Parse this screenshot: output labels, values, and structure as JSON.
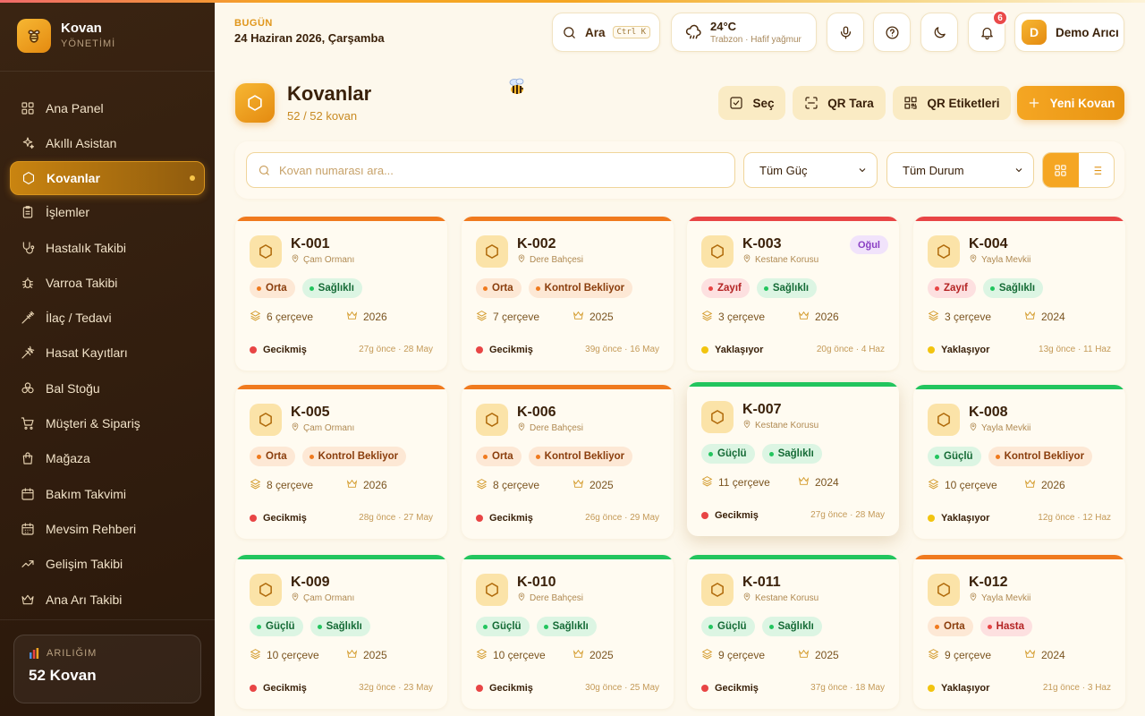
{
  "brand": {
    "title": "Kovan",
    "subtitle": "YÖNETİMİ"
  },
  "nav": [
    {
      "label": "Ana Panel",
      "icon": "grid-icon"
    },
    {
      "label": "Akıllı Asistan",
      "icon": "sparkles-icon"
    },
    {
      "label": "Kovanlar",
      "icon": "hexagon-icon",
      "active": true
    },
    {
      "label": "İşlemler",
      "icon": "clipboard-icon"
    },
    {
      "label": "Hastalık Takibi",
      "icon": "stethoscope-icon"
    },
    {
      "label": "Varroa Takibi",
      "icon": "bug-icon"
    },
    {
      "label": "İlaç / Tedavi",
      "icon": "syringe-icon"
    },
    {
      "label": "Hasat Kayıtları",
      "icon": "wheat-icon"
    },
    {
      "label": "Bal Stoğu",
      "icon": "boxes-icon"
    },
    {
      "label": "Müşteri & Sipariş",
      "icon": "cart-icon"
    },
    {
      "label": "Mağaza",
      "icon": "bag-icon"
    },
    {
      "label": "Bakım Takvimi",
      "icon": "calendar-icon"
    },
    {
      "label": "Mevsim Rehberi",
      "icon": "calendar-days-icon"
    },
    {
      "label": "Gelişim Takibi",
      "icon": "trending-up-icon"
    },
    {
      "label": "Ana Arı Takibi",
      "icon": "crown-icon"
    }
  ],
  "apiary": {
    "label": "ARILIĞIM",
    "value": "52 Kovan"
  },
  "header": {
    "date_label": "BUGÜN",
    "date_value": "24 Haziran 2026, Çarşamba",
    "search_label": "Ara",
    "search_shortcut": "Ctrl K",
    "weather_temp": "24°C",
    "weather_desc": "Trabzon · Hafif yağmur",
    "notification_count": "6",
    "user_initial": "D",
    "user_name": "Demo Arıcı"
  },
  "page": {
    "title": "Kovanlar",
    "subtitle": "52 / 52 kovan"
  },
  "actions": {
    "select": "Seç",
    "qr_scan": "QR Tara",
    "qr_labels": "QR Etiketleri",
    "new_hive": "Yeni Kovan"
  },
  "filters": {
    "search_placeholder": "Kovan numarası ara...",
    "strength": "Tüm Güç",
    "status": "Tüm Durum",
    "view_mode": "grid"
  },
  "colors": {
    "accent": "#f5a623",
    "orange": "#f07a1e",
    "red": "#e84545",
    "green": "#22c55e",
    "yellow": "#f2c40f"
  },
  "hives": [
    {
      "id": "K-001",
      "location": "Çam Ormanı",
      "strength": "Orta",
      "health": "Sağlıklı",
      "frames": "6 çerçeve",
      "year": "2026",
      "status": "Gecikmiş",
      "when": "27g önce · 28 May",
      "bar": "orange",
      "status_color": "red"
    },
    {
      "id": "K-002",
      "location": "Dere Bahçesi",
      "strength": "Orta",
      "health": "Kontrol Bekliyor",
      "frames": "7 çerçeve",
      "year": "2025",
      "status": "Gecikmiş",
      "when": "39g önce · 16 May",
      "bar": "orange",
      "status_color": "red"
    },
    {
      "id": "K-003",
      "location": "Kestane Korusu",
      "strength": "Zayıf",
      "health": "Sağlıklı",
      "frames": "3 çerçeve",
      "year": "2026",
      "status": "Yaklaşıyor",
      "when": "20g önce · 4 Haz",
      "bar": "red",
      "status_color": "yellow",
      "badge": "Oğul"
    },
    {
      "id": "K-004",
      "location": "Yayla Mevkii",
      "strength": "Zayıf",
      "health": "Sağlıklı",
      "frames": "3 çerçeve",
      "year": "2024",
      "status": "Yaklaşıyor",
      "when": "13g önce · 11 Haz",
      "bar": "red",
      "status_color": "yellow"
    },
    {
      "id": "K-005",
      "location": "Çam Ormanı",
      "strength": "Orta",
      "health": "Kontrol Bekliyor",
      "frames": "8 çerçeve",
      "year": "2026",
      "status": "Gecikmiş",
      "when": "28g önce · 27 May",
      "bar": "orange",
      "status_color": "red"
    },
    {
      "id": "K-006",
      "location": "Dere Bahçesi",
      "strength": "Orta",
      "health": "Kontrol Bekliyor",
      "frames": "8 çerçeve",
      "year": "2025",
      "status": "Gecikmiş",
      "when": "26g önce · 29 May",
      "bar": "orange",
      "status_color": "red"
    },
    {
      "id": "K-007",
      "location": "Kestane Korusu",
      "strength": "Güçlü",
      "health": "Sağlıklı",
      "frames": "11 çerçeve",
      "year": "2024",
      "status": "Gecikmiş",
      "when": "27g önce · 28 May",
      "bar": "green",
      "status_color": "red",
      "lifted": true
    },
    {
      "id": "K-008",
      "location": "Yayla Mevkii",
      "strength": "Güçlü",
      "health": "Kontrol Bekliyor",
      "frames": "10 çerçeve",
      "year": "2026",
      "status": "Yaklaşıyor",
      "when": "12g önce · 12 Haz",
      "bar": "green",
      "status_color": "yellow"
    },
    {
      "id": "K-009",
      "location": "Çam Ormanı",
      "strength": "Güçlü",
      "health": "Sağlıklı",
      "frames": "10 çerçeve",
      "year": "2025",
      "status": "Gecikmiş",
      "when": "32g önce · 23 May",
      "bar": "green",
      "status_color": "red"
    },
    {
      "id": "K-010",
      "location": "Dere Bahçesi",
      "strength": "Güçlü",
      "health": "Sağlıklı",
      "frames": "10 çerçeve",
      "year": "2025",
      "status": "Gecikmiş",
      "when": "30g önce · 25 May",
      "bar": "green",
      "status_color": "red"
    },
    {
      "id": "K-011",
      "location": "Kestane Korusu",
      "strength": "Güçlü",
      "health": "Sağlıklı",
      "frames": "9 çerçeve",
      "year": "2025",
      "status": "Gecikmiş",
      "when": "37g önce · 18 May",
      "bar": "green",
      "status_color": "red"
    },
    {
      "id": "K-012",
      "location": "Yayla Mevkii",
      "strength": "Orta",
      "health": "Hasta",
      "frames": "9 çerçeve",
      "year": "2024",
      "status": "Yaklaşıyor",
      "when": "21g önce · 3 Haz",
      "bar": "orange",
      "status_color": "yellow"
    }
  ]
}
